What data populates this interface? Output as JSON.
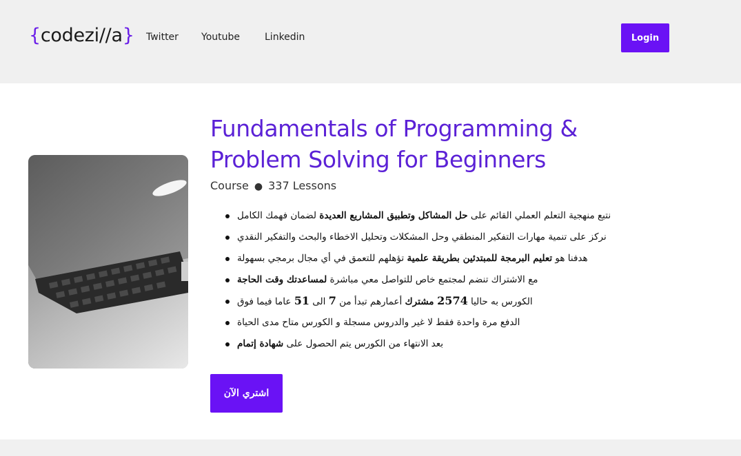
{
  "header": {
    "logo": {
      "open_brace": "{",
      "text": "codezi//a",
      "close_brace": "}"
    },
    "nav": [
      {
        "label": "Twitter"
      },
      {
        "label": "Youtube"
      },
      {
        "label": "Linkedin"
      }
    ],
    "login_label": "Login"
  },
  "course": {
    "title": "Fundamentals of Programming & Problem Solving for Beginners",
    "type": "Course",
    "lessons": "337 Lessons",
    "features": [
      {
        "pre": "نتبع منهجية التعلم العملي القائم على ",
        "bold": "حل المشاكل وتطبيق المشاريع العديدة",
        "post": " لضمان فهمك الكامل"
      },
      {
        "pre": "نركز على تنمية مهارات التفكير المنطقي وحل المشكلات وتحليل الاخطاء والبحث والتفكير النقدي",
        "bold": "",
        "post": ""
      },
      {
        "pre": "هدفنا هو ",
        "bold": "تعليم البرمجة للمبتدئين بطريقة علمية",
        "post": " تؤهلهم للتعمق في أي مجال برمجي بسهولة"
      },
      {
        "pre": "مع الاشتراك تنضم لمجتمع خاص للتواصل معي مباشرة ",
        "bold": "لمساعدتك وقت الحاجة",
        "post": ""
      },
      {
        "pre": "الكورس به حاليا ",
        "num1": "2574",
        "bold": " مشترك",
        "mid": " أعمارهم تبدأ من ",
        "num2": "7",
        "mid2": " الى ",
        "num3": "51",
        "post": " عاما فيما فوق"
      },
      {
        "pre": "الدفع مرة واحدة فقط لا غير والدروس مسجلة و الكورس متاح مدى الحياة",
        "bold": "",
        "post": ""
      },
      {
        "pre": "بعد الانتهاء من الكورس يتم الحصول على ",
        "bold": "شهادة إتمام",
        "post": ""
      }
    ],
    "buy_label": "اشتري الآن"
  },
  "colors": {
    "accent": "#6a12f5",
    "title": "#5b21d6",
    "header_bg": "#f0f0f0"
  },
  "icons": {
    "course_image": "laptop-image"
  }
}
